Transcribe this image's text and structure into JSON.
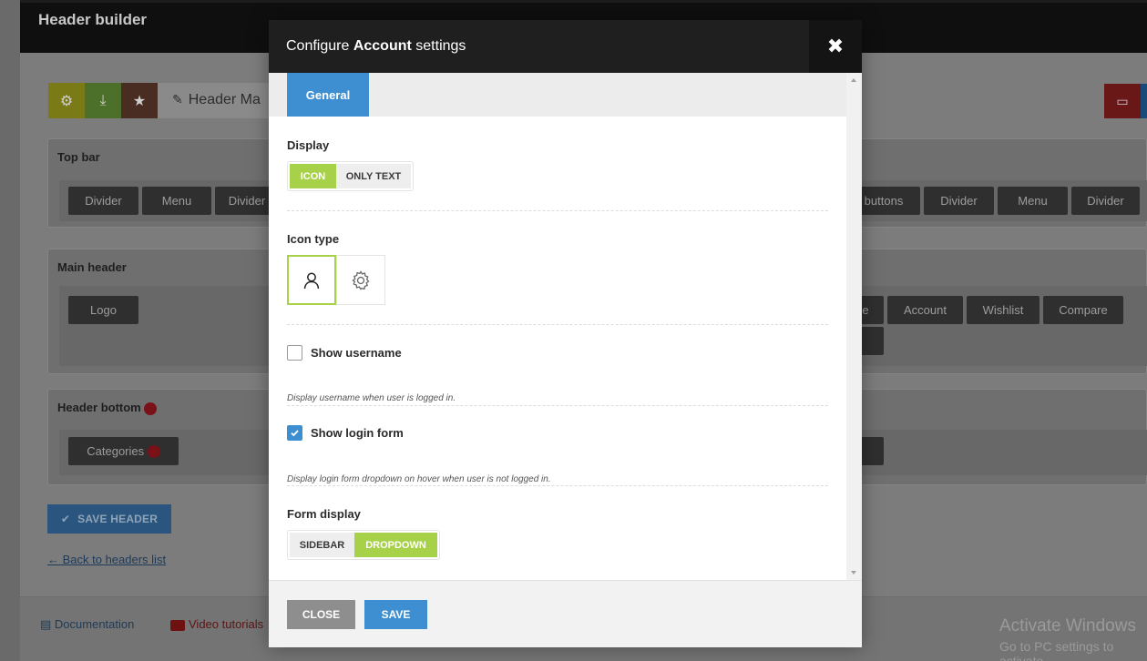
{
  "background": {
    "title": "Header builder",
    "header_name": "Header Ma",
    "sections": {
      "top_bar": {
        "title": "Top bar",
        "left_items": [
          "Divider",
          "Menu",
          "Divider"
        ],
        "right_items": [
          "buttons",
          "Divider",
          "Menu",
          "Divider"
        ]
      },
      "main_header": {
        "title": "Main header",
        "left_items": [
          "Logo"
        ],
        "right_items": [
          "e",
          "Account",
          "Wishlist",
          "Compare"
        ]
      },
      "header_bottom": {
        "title": "Header bottom",
        "left_items": [
          "Categories"
        ]
      }
    },
    "save_header": "SAVE HEADER",
    "save_check": "✔",
    "back_link": "← Back to headers list",
    "documentation": "Documentation",
    "video_tutorials": "Video tutorials"
  },
  "modal": {
    "title_prefix": "Configure ",
    "title_bold": "Account",
    "title_suffix": " settings",
    "close_icon": "✖",
    "tabs": [
      {
        "label": "General",
        "active": true
      }
    ],
    "display": {
      "label": "Display",
      "options": [
        {
          "label": "ICON",
          "selected": true
        },
        {
          "label": "ONLY TEXT",
          "selected": false
        }
      ]
    },
    "icon_type": {
      "label": "Icon type",
      "options": [
        {
          "icon": "user-icon",
          "selected": true
        },
        {
          "icon": "gear-icon",
          "selected": false
        }
      ]
    },
    "show_username": {
      "label": "Show username",
      "checked": false,
      "hint": "Display username when user is logged in."
    },
    "show_login_form": {
      "label": "Show login form",
      "checked": true,
      "hint": "Display login form dropdown on hover when user is not logged in."
    },
    "form_display": {
      "label": "Form display",
      "options": [
        {
          "label": "SIDEBAR",
          "selected": false
        },
        {
          "label": "DROPDOWN",
          "selected": true
        }
      ]
    },
    "footer": {
      "close": "CLOSE",
      "save": "SAVE"
    }
  },
  "os_watermark": {
    "line1": "Activate Windows",
    "line2": "Go to PC settings to activate"
  },
  "colors": {
    "accent_green": "#a8d14a",
    "accent_blue": "#3d8fd1",
    "modal_header": "#1f1f1f"
  }
}
